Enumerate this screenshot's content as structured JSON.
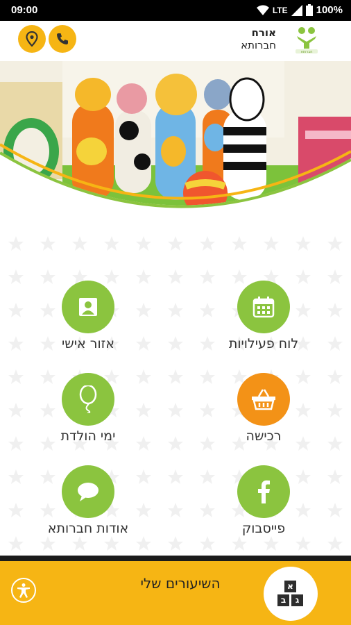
{
  "status_bar": {
    "time": "09:00",
    "network": "LTE",
    "battery": "100%"
  },
  "header": {
    "user_name": "אורח",
    "user_org": "חברותא",
    "logo_text": "חברותא"
  },
  "menu": {
    "items": [
      {
        "label": "לוח פעילויות",
        "icon": "calendar-icon",
        "color": "#8bc43f"
      },
      {
        "label": "אזור אישי",
        "icon": "person-icon",
        "color": "#8bc43f"
      },
      {
        "label": "רכישה",
        "icon": "basket-icon",
        "color": "#f39217"
      },
      {
        "label": "ימי הולדת",
        "icon": "balloon-icon",
        "color": "#8bc43f"
      },
      {
        "label": "פייסבוק",
        "icon": "facebook-icon",
        "color": "#8bc43f"
      },
      {
        "label": "אודות חברותא",
        "icon": "chat-icon",
        "color": "#8bc43f"
      }
    ]
  },
  "bottom_bar": {
    "title": "השיעורים שלי",
    "blocks_letters": [
      "א",
      "ב",
      "ג"
    ]
  },
  "colors": {
    "accent_yellow": "#f6b514",
    "green": "#8bc43f",
    "orange": "#f39217"
  }
}
